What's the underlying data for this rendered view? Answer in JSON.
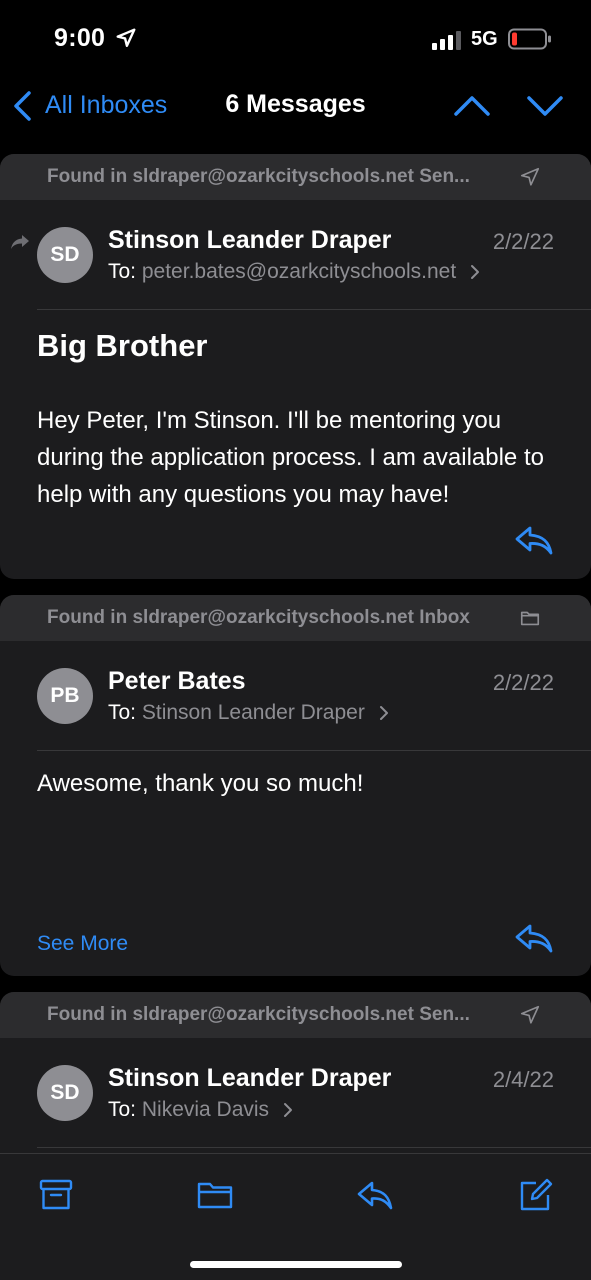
{
  "status_bar": {
    "time": "9:00",
    "network": "5G"
  },
  "nav": {
    "back_label": "All Inboxes",
    "title": "6 Messages"
  },
  "messages": [
    {
      "found_in": "Found in sldraper@ozarkcityschools.net Sen...",
      "folder_icon": "sent-icon",
      "initials": "SD",
      "sender": "Stinson Leander Draper",
      "date": "2/2/22",
      "to_label": "To:",
      "to": "peter.bates@ozarkcityschools.net",
      "subject": "Big Brother",
      "body": "Hey Peter, I'm Stinson. I'll be mentoring you during the application process. I am available to help with any questions you may have!"
    },
    {
      "found_in": "Found in sldraper@ozarkcityschools.net Inbox",
      "folder_icon": "folder-icon",
      "initials": "PB",
      "sender": "Peter Bates",
      "date": "2/2/22",
      "to_label": "To:",
      "to": "Stinson Leander Draper",
      "body": "Awesome, thank you so much!",
      "see_more": "See More"
    },
    {
      "found_in": "Found in sldraper@ozarkcityschools.net Sen...",
      "folder_icon": "sent-icon",
      "initials": "SD",
      "sender": "Stinson Leander Draper",
      "date": "2/4/22",
      "to_label": "To:",
      "to": "Nikevia Davis"
    }
  ],
  "toolbar": [
    "archive-icon",
    "folder-icon",
    "reply-icon",
    "compose-icon"
  ],
  "colors": {
    "accent": "#2f8bf5",
    "card": "#1c1c1e",
    "card_header": "#2c2c2e",
    "secondary_text": "#8e8e93",
    "battery_low": "#ff3b30"
  }
}
